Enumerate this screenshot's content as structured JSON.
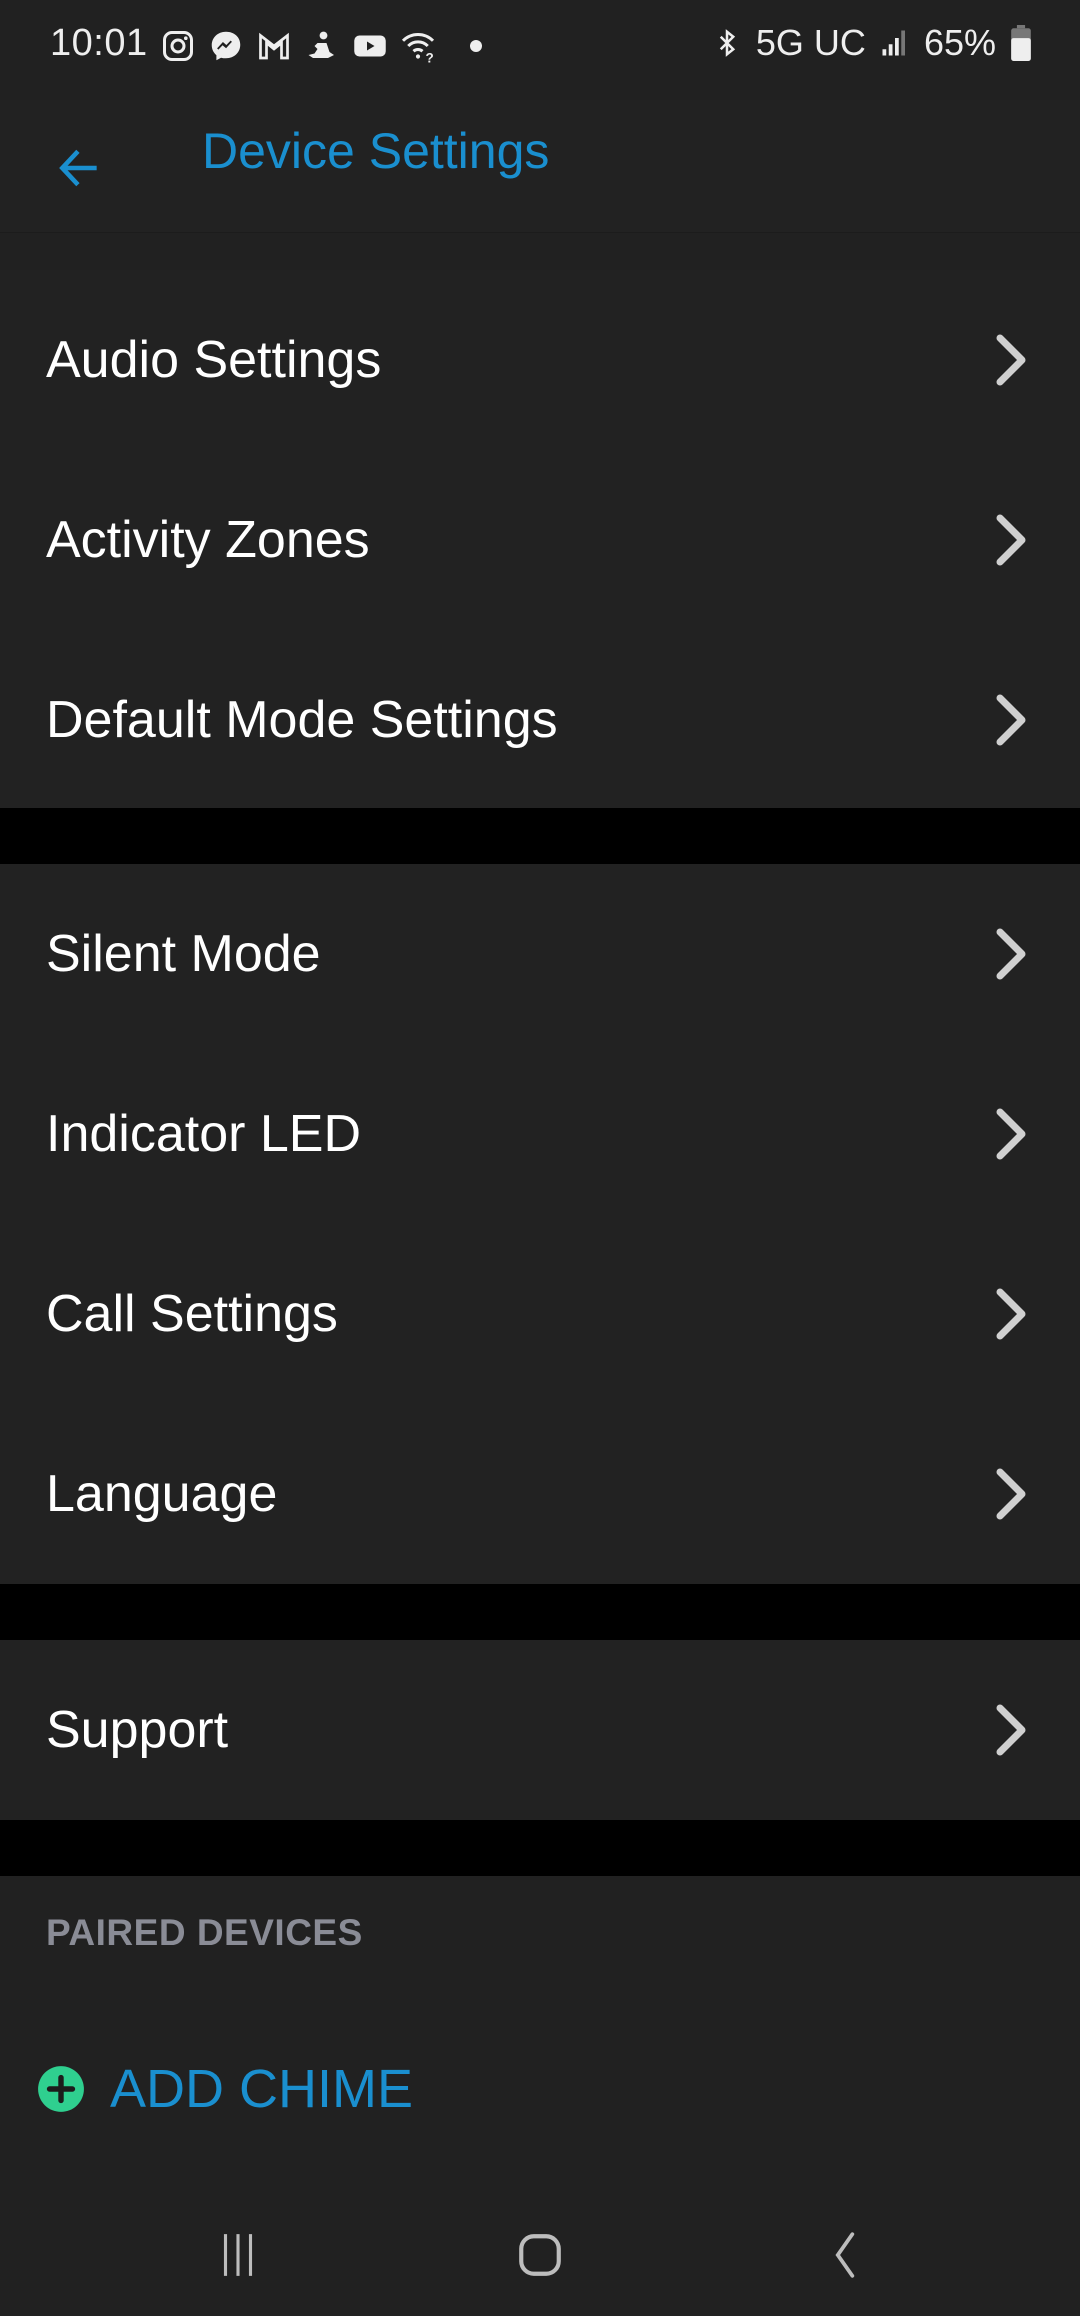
{
  "status_bar": {
    "time": "10:01",
    "notification_icons": [
      "instagram-icon",
      "messenger-icon",
      "gmail-icon",
      "meditation-app-icon",
      "youtube-icon",
      "wifi-question-icon",
      "dot-icon"
    ],
    "bluetooth": "bluetooth-icon",
    "network": "5G UC",
    "signal": "signal-bars-icon",
    "battery_percent": "65%",
    "battery_level": 0.65
  },
  "header": {
    "back_icon": "arrow-left-icon",
    "title": "Device Settings",
    "accent_color": "#1a8fcf"
  },
  "groups": [
    {
      "items": [
        {
          "label": "Audio Settings"
        },
        {
          "label": "Activity Zones"
        },
        {
          "label": "Default Mode Settings"
        }
      ]
    },
    {
      "items": [
        {
          "label": "Silent Mode"
        },
        {
          "label": "Indicator LED"
        },
        {
          "label": "Call Settings"
        },
        {
          "label": "Language"
        }
      ]
    },
    {
      "items": [
        {
          "label": "Support"
        }
      ]
    }
  ],
  "paired_devices": {
    "section_label": "PAIRED DEVICES",
    "add_button_label": "ADD CHIME",
    "add_icon_color": "#2fcf8f"
  },
  "nav_bar": {
    "recents": "recents-icon",
    "home": "home-icon",
    "back": "back-icon"
  }
}
